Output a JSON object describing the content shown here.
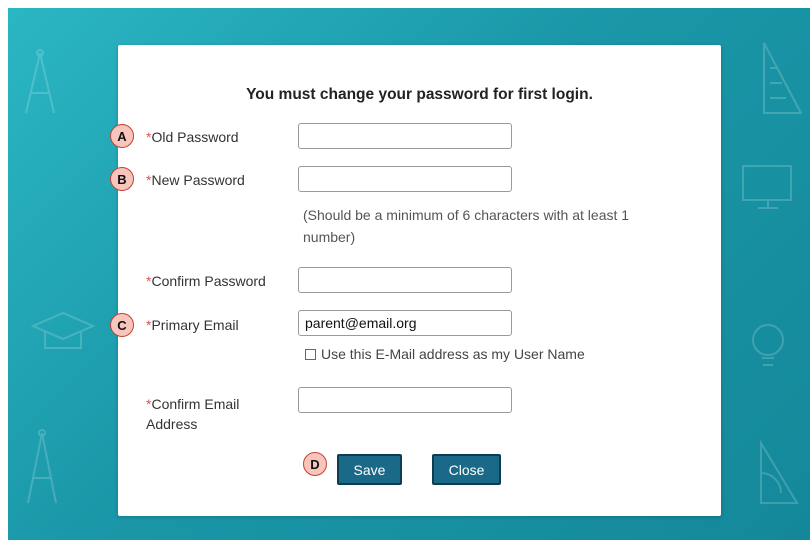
{
  "dialog": {
    "title": "You must change your password for first login."
  },
  "form": {
    "required_mark": "*",
    "old_password": {
      "label": "Old Password",
      "value": ""
    },
    "new_password": {
      "label": "New Password",
      "value": "",
      "hint_line1": "(Should be a minimum of 6 characters with at least 1",
      "hint_line2": "number)"
    },
    "confirm_password": {
      "label": "Confirm Password",
      "value": ""
    },
    "primary_email": {
      "label": "Primary Email",
      "value": "parent@email.org",
      "checkbox_label": "Use this E-Mail address as my User Name",
      "checkbox_checked": false
    },
    "confirm_email": {
      "label_line1": "Confirm Email",
      "label_line2": "Address",
      "value": ""
    }
  },
  "buttons": {
    "save": "Save",
    "close": "Close"
  },
  "markers": {
    "a": "A",
    "b": "B",
    "c": "C",
    "d": "D"
  },
  "colors": {
    "background_teal": "#1a97a8",
    "button": "#1b6988",
    "required": "#e05050",
    "marker_fill": "#f7c5bc",
    "marker_border": "#c2412f"
  }
}
